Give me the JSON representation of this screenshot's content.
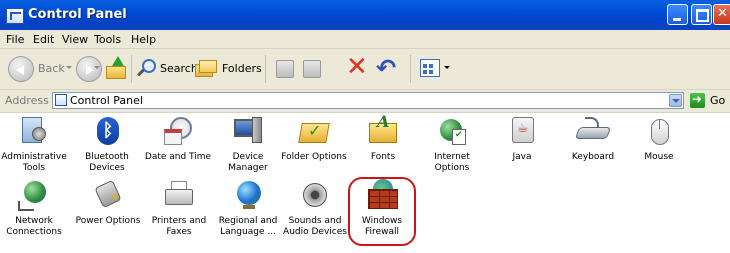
{
  "window": {
    "title": "Control Panel",
    "controls": {
      "minimize": "minimize-button",
      "maximize": "maximize-button",
      "close": "close-button"
    }
  },
  "menu": [
    "File",
    "Edit",
    "View",
    "Tools",
    "Help"
  ],
  "toolbar": {
    "back_label": "Back",
    "search_label": "Search",
    "folders_label": "Folders"
  },
  "address": {
    "label": "Address",
    "value": "Control Panel",
    "go_label": "Go"
  },
  "items": [
    {
      "label": "Administrative Tools",
      "icon": "administrative-tools-icon"
    },
    {
      "label": "Bluetooth Devices",
      "icon": "bluetooth-icon"
    },
    {
      "label": "Date and Time",
      "icon": "date-time-icon"
    },
    {
      "label": "Device Manager",
      "icon": "device-manager-icon"
    },
    {
      "label": "Folder Options",
      "icon": "folder-options-icon"
    },
    {
      "label": "Fonts",
      "icon": "fonts-icon"
    },
    {
      "label": "Internet Options",
      "icon": "internet-options-icon"
    },
    {
      "label": "Java",
      "icon": "java-icon"
    },
    {
      "label": "Keyboard",
      "icon": "keyboard-icon"
    },
    {
      "label": "Mouse",
      "icon": "mouse-icon"
    },
    {
      "label": "Network Connections",
      "icon": "network-connections-icon"
    },
    {
      "label": "Power Options",
      "icon": "power-options-icon"
    },
    {
      "label": "Printers and Faxes",
      "icon": "printers-faxes-icon"
    },
    {
      "label": "Regional and Language ...",
      "icon": "regional-language-icon"
    },
    {
      "label": "Sounds and Audio Devices",
      "icon": "sounds-audio-icon"
    },
    {
      "label": "Windows Firewall",
      "icon": "windows-firewall-icon"
    }
  ],
  "colors": {
    "titlebar": "#0052d8",
    "chrome": "#ece9d8",
    "highlight_ring": "#d01414"
  }
}
